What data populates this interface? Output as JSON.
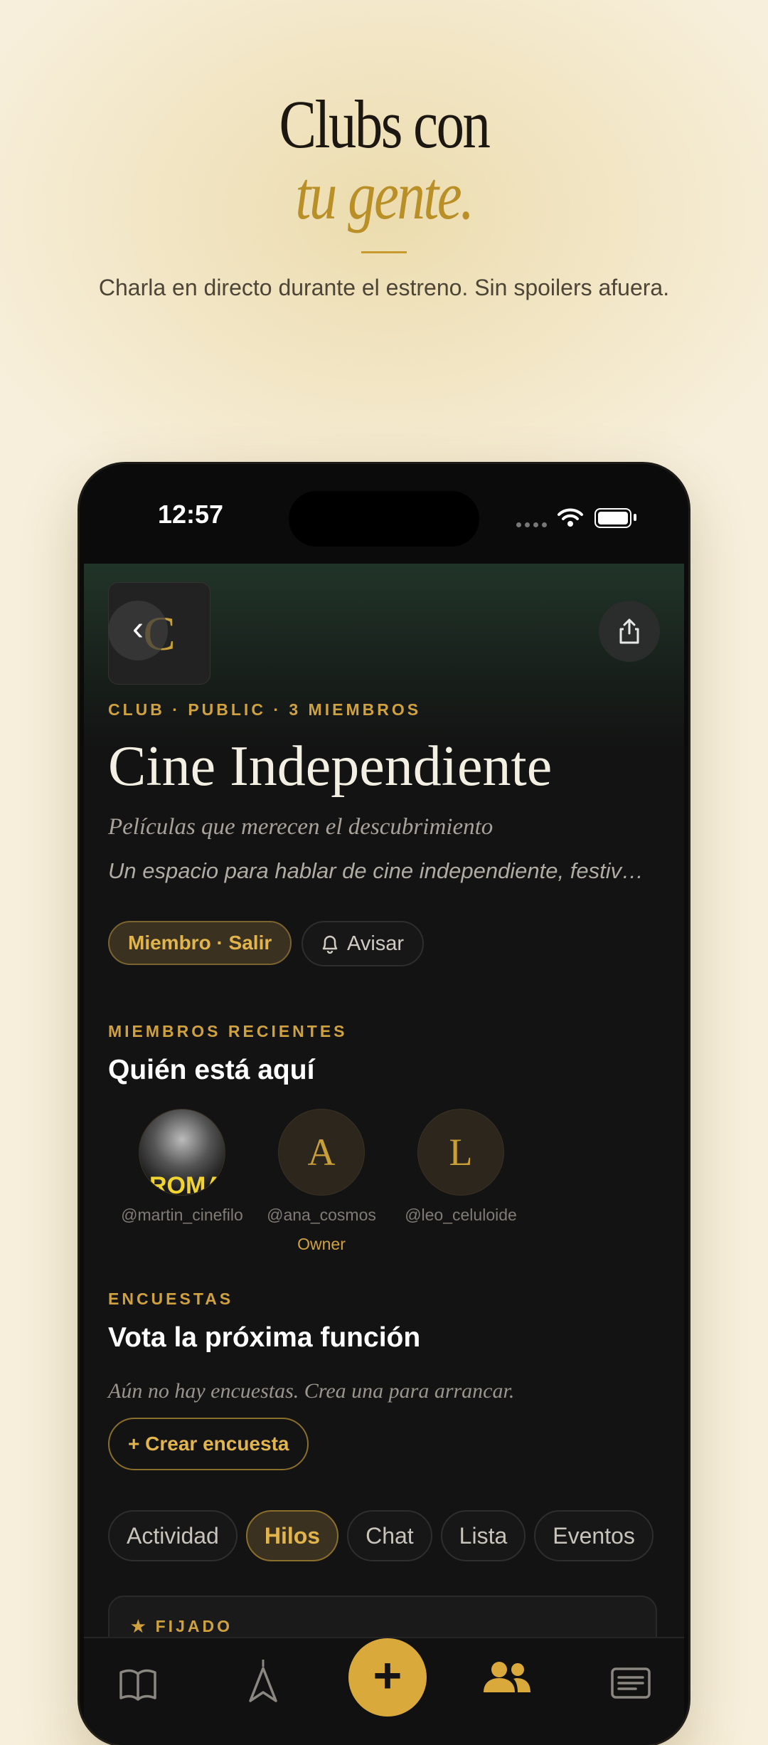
{
  "hero": {
    "line1": "Clubs con",
    "line2": "tu gente.",
    "subtitle": "Charla en directo durante el estreno. Sin spoilers afuera."
  },
  "status_bar": {
    "time": "12:57"
  },
  "club": {
    "logo_letter": "C",
    "meta": "CLUB · PUBLIC · 3 MIEMBROS",
    "title": "Cine Independiente",
    "tagline": "Películas que merecen el descubrimiento",
    "description": "Un espacio para hablar de cine independiente, festivales y joyas ocultas",
    "member_button": "Miembro · Salir",
    "notify_button": "Avisar"
  },
  "members": {
    "eyebrow": "MIEMBROS RECIENTES",
    "title": "Quién está aquí",
    "list": [
      {
        "handle": "@martin_cinefilo",
        "initial": "",
        "photo_text": "ROMA",
        "role": ""
      },
      {
        "handle": "@ana_cosmos",
        "initial": "A",
        "role": "Owner"
      },
      {
        "handle": "@leo_celuloide",
        "initial": "L",
        "role": ""
      }
    ]
  },
  "polls": {
    "eyebrow": "ENCUESTAS",
    "title": "Vota la próxima función",
    "empty": "Aún no hay encuestas. Crea una para arrancar.",
    "create_button": "+ Crear encuesta"
  },
  "tabs": [
    "Actividad",
    "Hilos",
    "Chat",
    "Lista",
    "Eventos"
  ],
  "active_tab": "Hilos",
  "pinned": {
    "label": "FIJADO"
  },
  "tabbar": {
    "icons": [
      "book-icon",
      "compass-icon",
      "plus-icon",
      "people-icon",
      "news-icon"
    ],
    "active": "people-icon"
  },
  "colors": {
    "accent": "#d9a93c",
    "background": "#131313",
    "hero_bg": "#f2e6c6"
  }
}
